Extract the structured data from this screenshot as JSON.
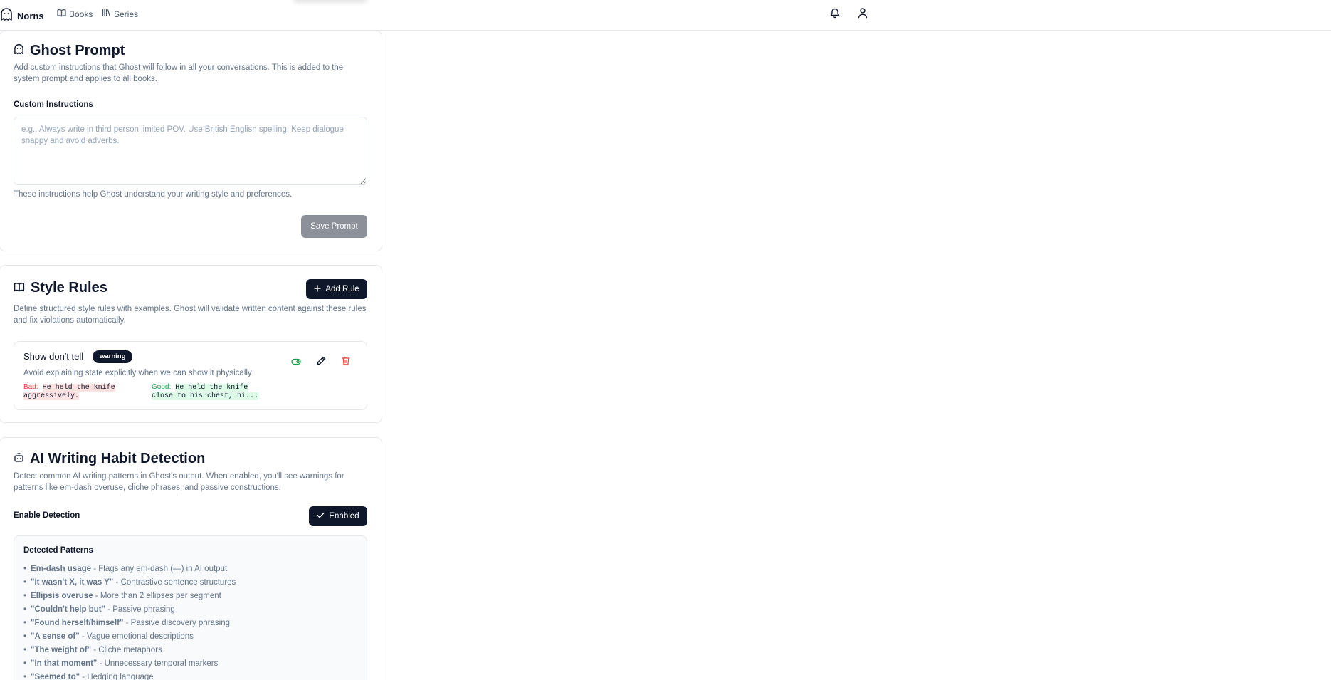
{
  "nav": {
    "brand": "Norns",
    "links": [
      {
        "label": "Books",
        "icon": "book-open-icon"
      },
      {
        "label": "Series",
        "icon": "library-icon"
      }
    ]
  },
  "ghost_prompt": {
    "title": "Ghost Prompt",
    "description": "Add custom instructions that Ghost will follow in all your conversations. This is added to the system prompt and applies to all books.",
    "field_label": "Custom Instructions",
    "field_value": "",
    "field_placeholder": "e.g., Always write in third person limited POV. Use British English spelling. Keep dialogue snappy and avoid adverbs.",
    "help_text": "These instructions help Ghost understand your writing style and preferences.",
    "save_label": "Save Prompt"
  },
  "style_rules": {
    "title": "Style Rules",
    "add_label": "Add Rule",
    "description": "Define structured style rules with examples. Ghost will validate written content against these rules and fix violations automatically.",
    "rules": [
      {
        "name": "Show don't tell",
        "severity": "warning",
        "description": "Avoid explaining state explicitly when we can show it physically",
        "bad_label": "Bad:",
        "bad_example": "He held the knife aggressively.",
        "good_label": "Good:",
        "good_example": "He held the knife close to his chest, hi..."
      }
    ]
  },
  "ai_detection": {
    "title": "AI Writing Habit Detection",
    "description": "Detect common AI writing patterns in Ghost's output. When enabled, you'll see warnings for patterns like em-dash overuse, cliche phrases, and passive constructions.",
    "enable_label": "Enable Detection",
    "enabled_button": "Enabled",
    "patterns_title": "Detected Patterns",
    "patterns": [
      {
        "name": "Em-dash usage",
        "desc": " - Flags any em-dash (—) in AI output"
      },
      {
        "name": "\"It wasn't X, it was Y\"",
        "desc": " - Contrastive sentence structures"
      },
      {
        "name": "Ellipsis overuse",
        "desc": " - More than 2 ellipses per segment"
      },
      {
        "name": "\"Couldn't help but\"",
        "desc": " - Passive phrasing"
      },
      {
        "name": "\"Found herself/himself\"",
        "desc": " - Passive discovery phrasing"
      },
      {
        "name": "\"A sense of\"",
        "desc": " - Vague emotional descriptions"
      },
      {
        "name": "\"The weight of\"",
        "desc": " - Cliche metaphors"
      },
      {
        "name": "\"In that moment\"",
        "desc": " - Unnecessary temporal markers"
      },
      {
        "name": "\"Seemed to\"",
        "desc": " - Hedging language"
      }
    ]
  },
  "colors": {
    "primary": "#0f172a",
    "muted_text": "#64748b",
    "border": "#e5e7eb",
    "disabled_button": "#8c9099",
    "bad": "#ef4444",
    "good": "#16a34a"
  }
}
